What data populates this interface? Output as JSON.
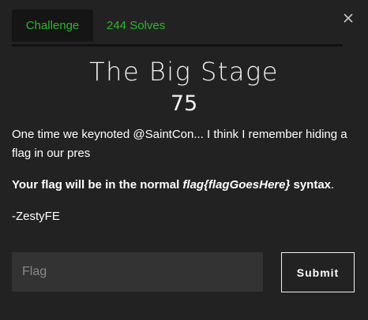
{
  "close_label": "×",
  "tabs": [
    {
      "label": "Challenge",
      "active": true
    },
    {
      "label": "244 Solves",
      "active": false
    }
  ],
  "challenge": {
    "name": "The Big Stage",
    "points": "75",
    "description_line1": "One time we keynoted @SaintCon... I think I remember hiding a flag in our pres",
    "flag_hint_prefix": "Your flag will be in the normal ",
    "flag_hint_format": "flag{flagGoesHere}",
    "flag_hint_suffix": " syntax",
    "flag_hint_period": ".",
    "author": "-ZestyFE"
  },
  "form": {
    "flag_placeholder": "Flag",
    "flag_value": "",
    "submit_label": "Submit"
  },
  "colors": {
    "background": "#222222",
    "tab_text": "#2fb52f",
    "active_tab_bg": "#151515",
    "input_bg": "#333333"
  }
}
